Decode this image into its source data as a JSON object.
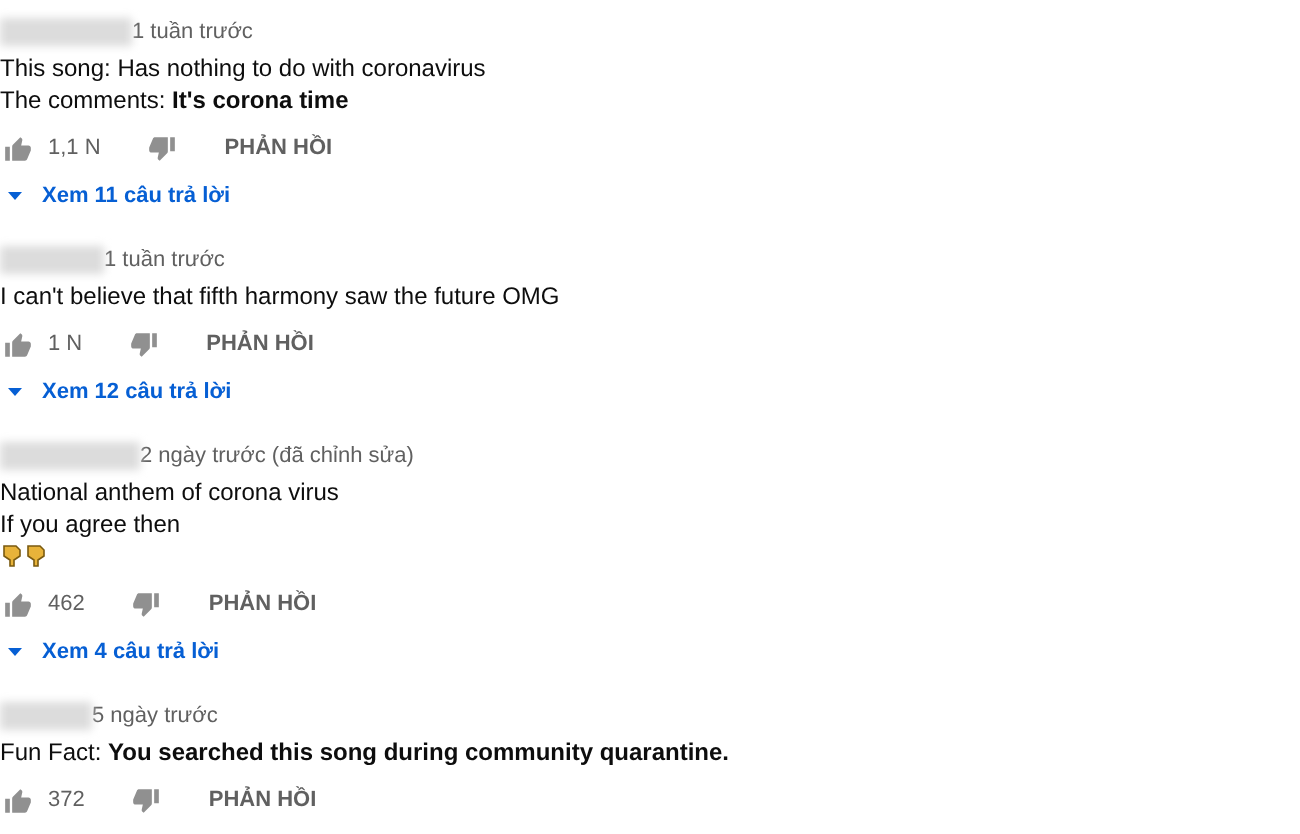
{
  "comments": [
    {
      "time": "1 tuần trước",
      "lines": [
        "This song: Has nothing to do with coronavirus",
        "The comments: **It's corona time**"
      ],
      "likes": "1,1 N",
      "reply_label": "PHẢN HỒI",
      "replies": "Xem 11 câu trả lời"
    },
    {
      "time": "1 tuần trước",
      "lines": [
        "I can't believe that fifth harmony saw the future OMG"
      ],
      "likes": "1 N",
      "reply_label": "PHẢN HỒI",
      "replies": "Xem 12 câu trả lời"
    },
    {
      "time": "2 ngày trước (đã chỉnh sửa)",
      "lines": [
        "National anthem of corona virus",
        "If you agree then"
      ],
      "emojis": [
        {
          "kind": "pointing-down"
        },
        {
          "kind": "pointing-down"
        }
      ],
      "likes": "462",
      "reply_label": "PHẢN HỒI",
      "replies": "Xem 4 câu trả lời"
    },
    {
      "time": "5 ngày trước",
      "lines": [
        "Fun Fact: **You searched this song during community quarantine.**"
      ],
      "likes": "372",
      "reply_label": "PHẢN HỒI"
    }
  ]
}
